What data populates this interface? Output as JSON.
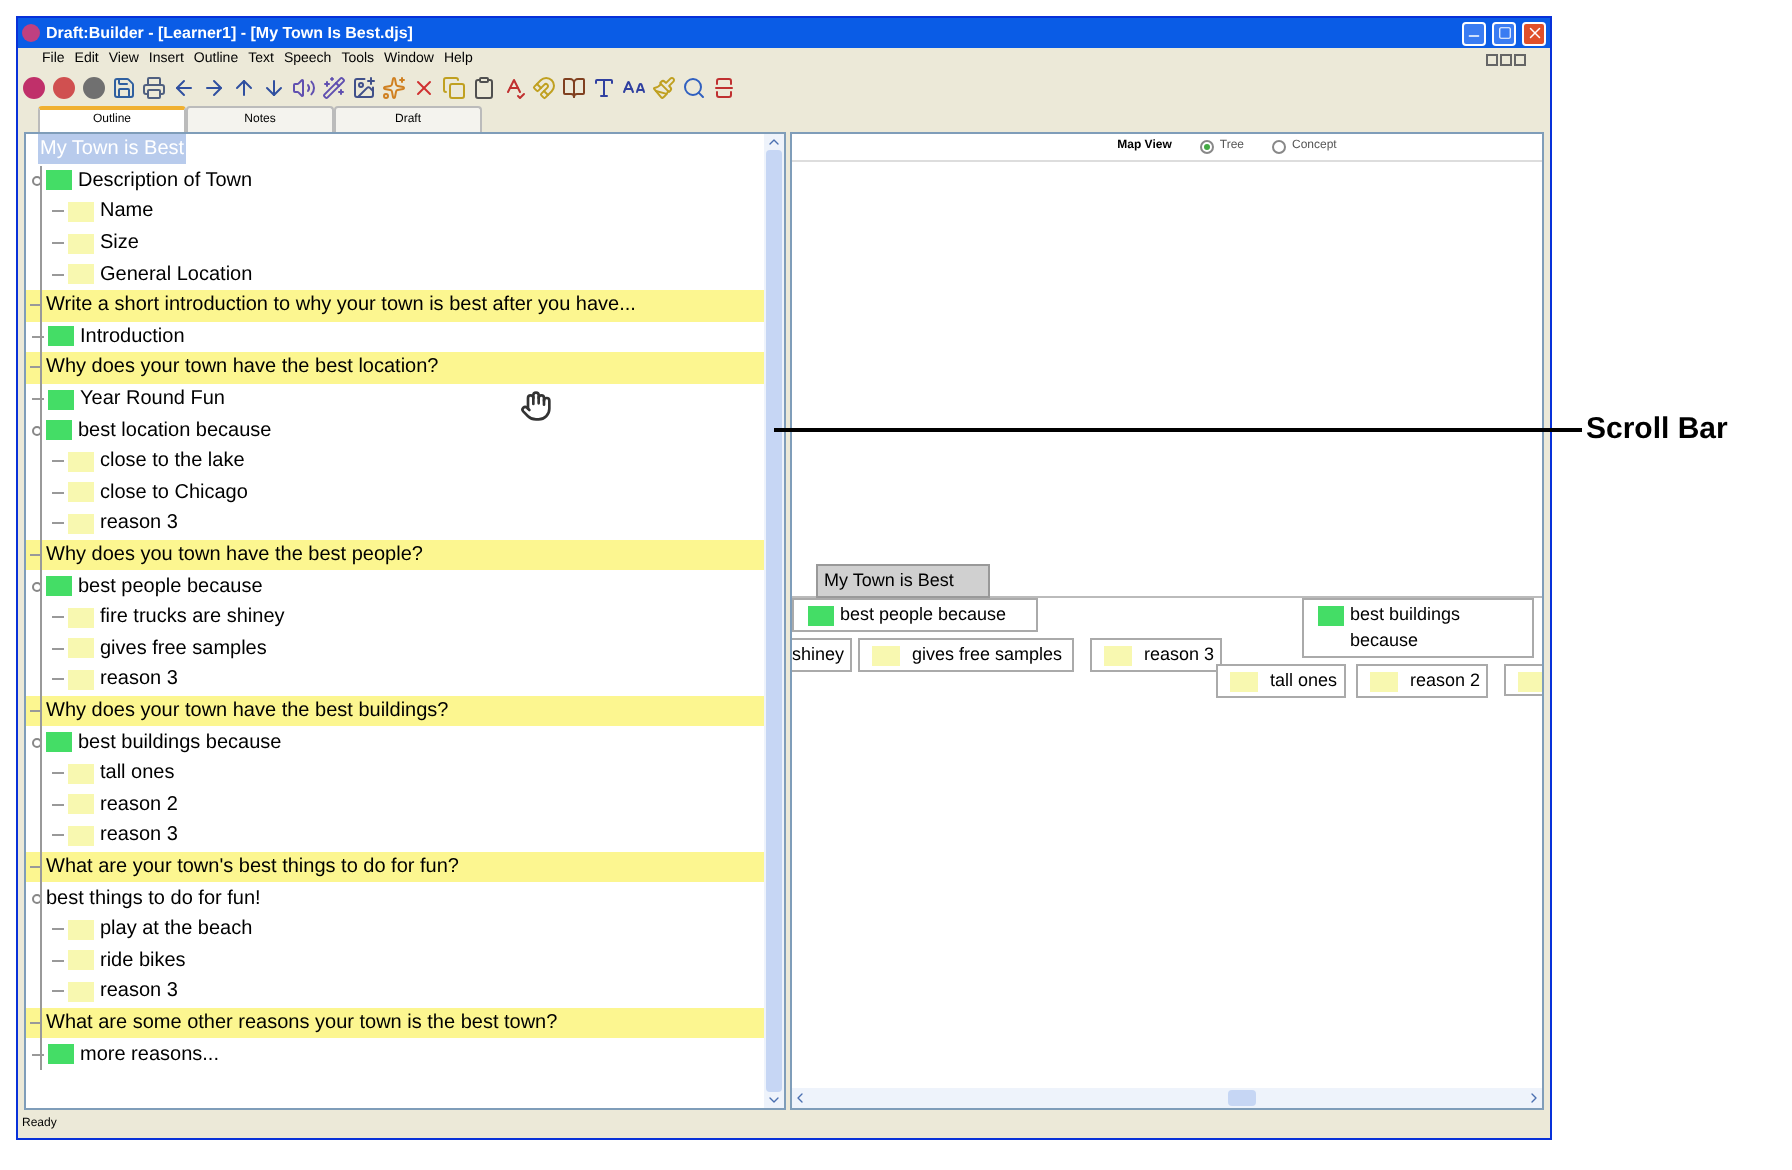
{
  "window": {
    "title": "Draft:Builder - [Learner1] - [My Town Is Best.djs]"
  },
  "menu": [
    "File",
    "Edit",
    "View",
    "Insert",
    "Outline",
    "Text",
    "Speech",
    "Tools",
    "Window",
    "Help"
  ],
  "tabs": [
    {
      "label": "Outline",
      "selected": true
    },
    {
      "label": "Notes",
      "selected": false
    },
    {
      "label": "Draft",
      "selected": false
    }
  ],
  "outline": {
    "root": {
      "text": "My Town is Best",
      "selected": true,
      "children": [
        {
          "kind": "topic",
          "text": "Description of Town",
          "children": [
            {
              "kind": "note",
              "text": "Name"
            },
            {
              "kind": "note",
              "text": "Size"
            },
            {
              "kind": "note",
              "text": "General Location"
            }
          ]
        },
        {
          "kind": "prompt",
          "text": "Write a short introduction to why your town is best after you have..."
        },
        {
          "kind": "topic",
          "text": "Introduction"
        },
        {
          "kind": "prompt",
          "text": "Why does your town have the best location?"
        },
        {
          "kind": "topic",
          "text": "Year Round Fun"
        },
        {
          "kind": "topic",
          "text": "best location because",
          "children": [
            {
              "kind": "note",
              "text": "close to the lake"
            },
            {
              "kind": "note",
              "text": "close to Chicago"
            },
            {
              "kind": "note",
              "text": "reason 3"
            }
          ]
        },
        {
          "kind": "prompt",
          "text": "Why does you town have the best people?"
        },
        {
          "kind": "topic",
          "text": "best people because",
          "children": [
            {
              "kind": "note",
              "text": "fire trucks are shiney"
            },
            {
              "kind": "note",
              "text": "gives free samples"
            },
            {
              "kind": "note",
              "text": "reason 3"
            }
          ]
        },
        {
          "kind": "prompt",
          "text": "Why does your town have the best buildings?"
        },
        {
          "kind": "topic",
          "text": "best buildings because",
          "children": [
            {
              "kind": "note",
              "text": "tall ones"
            },
            {
              "kind": "note",
              "text": "reason 2"
            },
            {
              "kind": "note",
              "text": "reason 3"
            }
          ]
        },
        {
          "kind": "prompt",
          "text": "What are your town's best things to do for fun?"
        },
        {
          "kind": "plain",
          "text": "best things to do for fun!",
          "children": [
            {
              "kind": "note",
              "text": "play at the beach"
            },
            {
              "kind": "note",
              "text": "ride bikes"
            },
            {
              "kind": "note",
              "text": "reason 3"
            }
          ]
        },
        {
          "kind": "prompt",
          "text": "What are some other reasons your town is the best town?"
        },
        {
          "kind": "topic",
          "text": "more reasons..."
        }
      ]
    }
  },
  "map": {
    "label": "Map View",
    "views": [
      {
        "label": "Tree",
        "selected": true
      },
      {
        "label": "Concept",
        "selected": false
      }
    ],
    "nodes": [
      {
        "kind": "root",
        "text": "My Town is Best"
      },
      {
        "kind": "topic",
        "text": "best people because"
      },
      {
        "kind": "topic",
        "text": "best buildings because"
      },
      {
        "kind": "cut",
        "text": "shiney"
      },
      {
        "kind": "note",
        "text": "gives free samples"
      },
      {
        "kind": "note",
        "text": "reason 3"
      },
      {
        "kind": "note",
        "text": "tall ones"
      },
      {
        "kind": "note",
        "text": "reason 2"
      },
      {
        "kind": "note"
      }
    ]
  },
  "status_bar": "Ready",
  "annotation": {
    "label": "Scroll Bar"
  }
}
